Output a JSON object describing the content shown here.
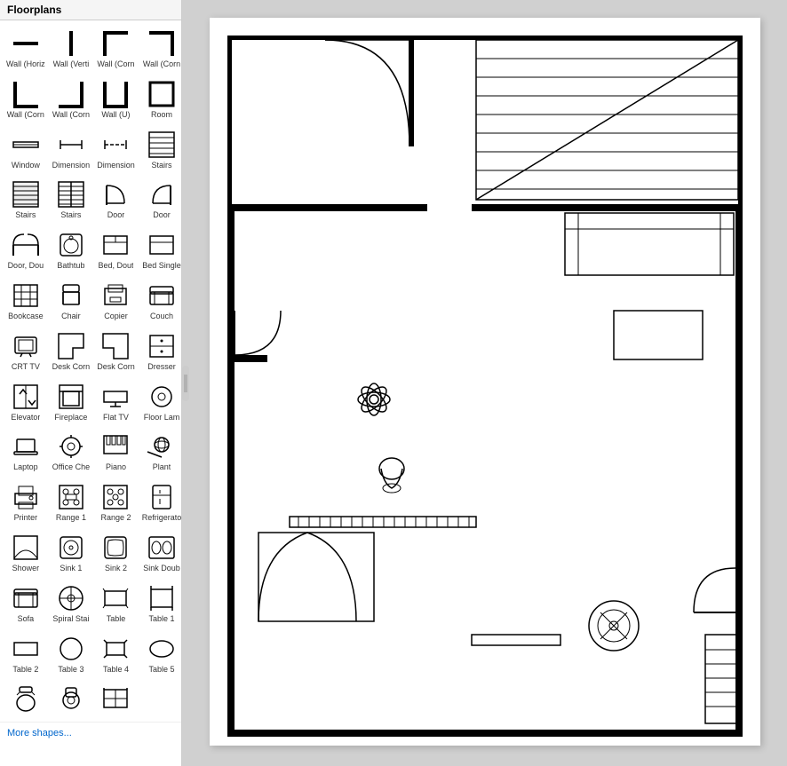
{
  "app": {
    "title": "Floorplans"
  },
  "sidebar": {
    "title": "Floorplans",
    "more_shapes_label": "More shapes...",
    "shapes": [
      {
        "id": "wall-horiz",
        "label": "Wall (Horiz"
      },
      {
        "id": "wall-vert",
        "label": "Wall (Verti"
      },
      {
        "id": "wall-corner1",
        "label": "Wall (Corn"
      },
      {
        "id": "wall-corner2",
        "label": "Wall (Corn"
      },
      {
        "id": "wall-corner3",
        "label": "Wall (Corn"
      },
      {
        "id": "wall-corner4",
        "label": "Wall (Corn"
      },
      {
        "id": "wall-u",
        "label": "Wall (U)"
      },
      {
        "id": "room",
        "label": "Room"
      },
      {
        "id": "window",
        "label": "Window"
      },
      {
        "id": "dimension1",
        "label": "Dimension"
      },
      {
        "id": "dimension2",
        "label": "Dimension"
      },
      {
        "id": "stairs1",
        "label": "Stairs"
      },
      {
        "id": "stairs2",
        "label": "Stairs"
      },
      {
        "id": "stairs3",
        "label": "Stairs"
      },
      {
        "id": "door1",
        "label": "Door"
      },
      {
        "id": "door2",
        "label": "Door"
      },
      {
        "id": "door-double",
        "label": "Door, Dou"
      },
      {
        "id": "bathtub",
        "label": "Bathtub"
      },
      {
        "id": "bed-double",
        "label": "Bed, Dout"
      },
      {
        "id": "bed-single",
        "label": "Bed Single"
      },
      {
        "id": "bookcase",
        "label": "Bookcase"
      },
      {
        "id": "chair",
        "label": "Chair"
      },
      {
        "id": "copier",
        "label": "Copier"
      },
      {
        "id": "couch",
        "label": "Couch"
      },
      {
        "id": "crt-tv",
        "label": "CRT TV"
      },
      {
        "id": "desk-corn1",
        "label": "Desk Corn"
      },
      {
        "id": "desk-corn2",
        "label": "Desk Corn"
      },
      {
        "id": "dresser",
        "label": "Dresser"
      },
      {
        "id": "elevator",
        "label": "Elevator"
      },
      {
        "id": "fireplace",
        "label": "Fireplace"
      },
      {
        "id": "flat-tv",
        "label": "Flat TV"
      },
      {
        "id": "floor-lamp",
        "label": "Floor Lam"
      },
      {
        "id": "laptop",
        "label": "Laptop"
      },
      {
        "id": "office-chair",
        "label": "Office Che"
      },
      {
        "id": "piano",
        "label": "Piano"
      },
      {
        "id": "plant",
        "label": "Plant"
      },
      {
        "id": "printer",
        "label": "Printer"
      },
      {
        "id": "range1",
        "label": "Range 1"
      },
      {
        "id": "range2",
        "label": "Range 2"
      },
      {
        "id": "refrigerator",
        "label": "Refrigerato"
      },
      {
        "id": "shower",
        "label": "Shower"
      },
      {
        "id": "sink1",
        "label": "Sink 1"
      },
      {
        "id": "sink2",
        "label": "Sink 2"
      },
      {
        "id": "sink-double",
        "label": "Sink Doub"
      },
      {
        "id": "sofa",
        "label": "Sofa"
      },
      {
        "id": "spiral-stair",
        "label": "Spiral Stai"
      },
      {
        "id": "table",
        "label": "Table"
      },
      {
        "id": "table1",
        "label": "Table 1"
      },
      {
        "id": "table2",
        "label": "Table 2"
      },
      {
        "id": "table3",
        "label": "Table 3"
      },
      {
        "id": "table4",
        "label": "Table 4"
      },
      {
        "id": "table5",
        "label": "Table 5"
      },
      {
        "id": "toilet1",
        "label": ""
      },
      {
        "id": "toilet2",
        "label": ""
      },
      {
        "id": "cabinet",
        "label": ""
      }
    ]
  }
}
